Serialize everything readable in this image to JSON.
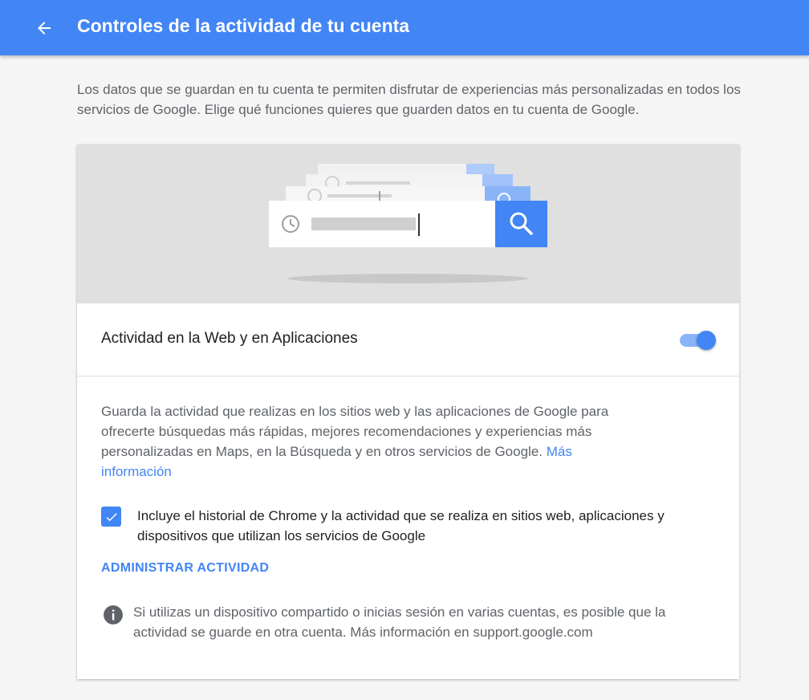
{
  "header": {
    "title": "Controles de la actividad de tu cuenta",
    "back_icon": "arrow-left-icon",
    "color": "#4285f4"
  },
  "intro": {
    "text": "Los datos que se guardan en tu cuenta te permiten disfrutar de experiencias más personalizadas en todos los servicios de Google. Elige qué funciones quieres que guarden datos en tu cuenta de Google."
  },
  "setting": {
    "title": "Actividad en la Web y en Aplicaciones",
    "enabled": true,
    "description": "Guarda la actividad que realizas en los sitios web y las aplicaciones de Google para ofrecerte búsquedas más rápidas, mejores recomendaciones y experiencias más personalizadas en Maps, en la Búsqueda y en otros servicios de Google.",
    "more_link": "Más información",
    "checkbox_checked": true,
    "checkbox_label": "Incluye el historial de Chrome y la actividad que se realiza en sitios web, aplicaciones y dispositivos que utilizan los servicios de Google",
    "manage_button": "ADMINISTRAR ACTIVIDAD",
    "info_text": "Si utilizas un dispositivo compartido o inicias sesión en varias cuentas, es posible que la actividad se guarde en otra cuenta. Más información en support.google.com",
    "info_icon": "info-icon"
  },
  "colors": {
    "accent": "#4285f4",
    "toggle_track": "#8ab4f8",
    "illustration_bg": "#e0e0e0"
  }
}
